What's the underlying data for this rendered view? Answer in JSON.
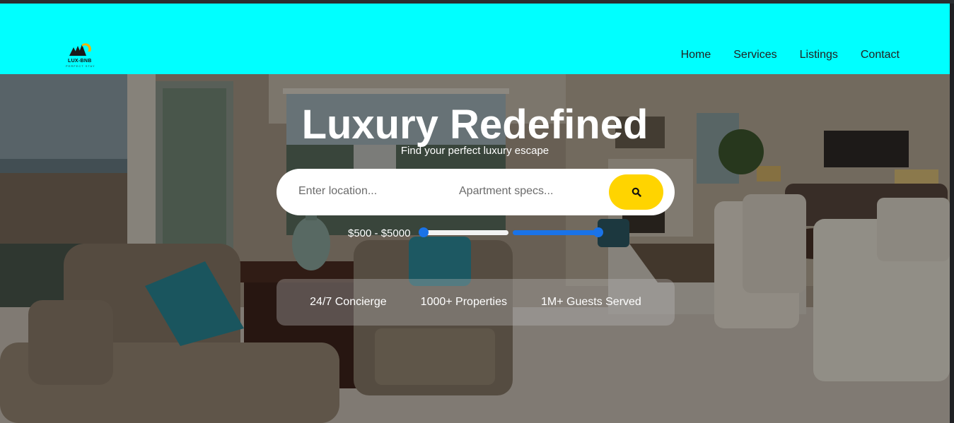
{
  "header": {
    "logo_text": "LUX-BNB",
    "logo_sub": "PERFECT STAY",
    "nav": [
      "Home",
      "Services",
      "Listings",
      "Contact"
    ]
  },
  "hero": {
    "title": "Luxury Redefined",
    "subtitle": "Find your perfect luxury escape",
    "search": {
      "location_placeholder": "Enter location...",
      "specs_placeholder": "Apartment specs...",
      "button_icon": "search-icon"
    },
    "price": {
      "label": "$500 - $5000",
      "min": 500,
      "max": 5000
    },
    "stats": [
      "24/7 Concierge",
      "1000+ Properties",
      "1M+ Guests Served"
    ]
  },
  "colors": {
    "header_bg": "#00ffff",
    "accent_yellow": "#ffd400",
    "slider_blue": "#1a73e8"
  }
}
